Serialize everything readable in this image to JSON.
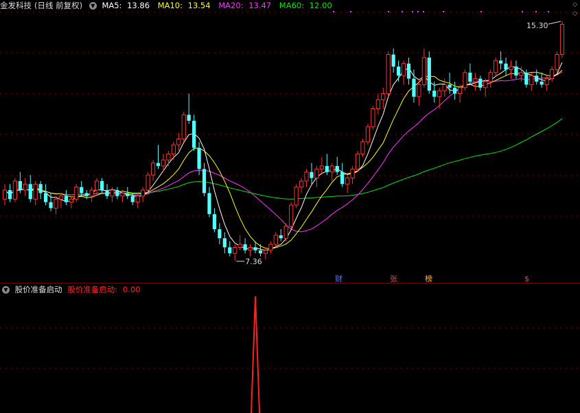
{
  "header": {
    "stock_name": "金发科技",
    "period": "(日线 前复权)",
    "ma5_label": "MA5:",
    "ma5_value": "13.86",
    "ma10_label": "MA10:",
    "ma10_value": "13.54",
    "ma20_label": "MA20:",
    "ma20_value": "13.47",
    "ma60_label": "MA60:",
    "ma60_value": "12.00",
    "icon": "chevron-down-icon"
  },
  "indicator": {
    "name": "股价准备启动",
    "series_label": "股价准备启动:",
    "value": "0.00",
    "icon": "chevron-down-icon"
  },
  "annotations": {
    "high_label": "15.30",
    "low_label": "7.36",
    "event_cai": "财",
    "event_zhang": "张",
    "event_bang": "榜",
    "event_dollar": "$"
  },
  "colors": {
    "up": "#ff3232",
    "down": "#54ffff",
    "ma5": "#ffffff",
    "ma10": "#ffff00",
    "ma20": "#ff33ff",
    "ma60": "#00e600",
    "grid": "#8b0000",
    "signal": "#ff2020"
  },
  "chart_data": [
    {
      "type": "candlestick",
      "title": "金发科技(日线 前复权)",
      "ylim": [
        6.9,
        15.6
      ],
      "annotations": [
        {
          "text": "15.30",
          "value": 15.3
        },
        {
          "text": "7.36",
          "value": 7.36
        }
      ],
      "candles": [
        [
          9.4,
          9.9,
          9.2,
          9.7
        ],
        [
          9.7,
          9.9,
          9.3,
          9.4
        ],
        [
          9.4,
          10.1,
          9.3,
          10.0
        ],
        [
          10.0,
          10.3,
          9.6,
          9.7
        ],
        [
          9.7,
          10.1,
          9.5,
          9.9
        ],
        [
          9.9,
          10.2,
          9.3,
          9.4
        ],
        [
          9.4,
          10.0,
          9.2,
          9.9
        ],
        [
          9.9,
          10.0,
          9.4,
          9.6
        ],
        [
          9.6,
          9.9,
          9.2,
          9.3
        ],
        [
          9.3,
          9.6,
          9.0,
          9.1
        ],
        [
          9.1,
          9.5,
          8.9,
          9.4
        ],
        [
          9.4,
          9.6,
          9.1,
          9.5
        ],
        [
          9.5,
          9.7,
          9.2,
          9.3
        ],
        [
          9.3,
          9.5,
          9.1,
          9.4
        ],
        [
          9.4,
          9.9,
          9.3,
          9.8
        ],
        [
          9.8,
          10.0,
          9.5,
          9.6
        ],
        [
          9.6,
          9.7,
          9.4,
          9.5
        ],
        [
          9.5,
          9.8,
          9.3,
          9.7
        ],
        [
          9.7,
          10.1,
          9.5,
          10.0
        ],
        [
          10.0,
          10.1,
          9.6,
          9.7
        ],
        [
          9.7,
          9.9,
          9.4,
          9.5
        ],
        [
          9.5,
          9.8,
          9.3,
          9.7
        ],
        [
          9.7,
          9.8,
          9.4,
          9.5
        ],
        [
          9.5,
          9.7,
          9.3,
          9.6
        ],
        [
          9.6,
          9.8,
          9.4,
          9.5
        ],
        [
          9.5,
          9.6,
          9.2,
          9.3
        ],
        [
          9.3,
          9.6,
          9.1,
          9.5
        ],
        [
          9.5,
          9.8,
          9.3,
          9.7
        ],
        [
          9.7,
          10.3,
          9.6,
          10.2
        ],
        [
          10.2,
          10.7,
          10.0,
          10.6
        ],
        [
          10.6,
          11.2,
          10.4,
          10.5
        ],
        [
          10.5,
          10.9,
          10.3,
          10.7
        ],
        [
          10.7,
          11.0,
          10.5,
          10.9
        ],
        [
          10.9,
          11.3,
          10.7,
          11.2
        ],
        [
          11.2,
          11.6,
          11.0,
          11.4
        ],
        [
          11.4,
          12.3,
          11.3,
          12.2
        ],
        [
          12.2,
          12.9,
          11.9,
          12.0
        ],
        [
          12.0,
          12.2,
          11.0,
          11.1
        ],
        [
          11.1,
          11.3,
          10.2,
          10.4
        ],
        [
          10.4,
          10.6,
          9.5,
          9.6
        ],
        [
          9.6,
          9.8,
          8.8,
          8.9
        ],
        [
          8.9,
          9.1,
          8.3,
          8.4
        ],
        [
          8.4,
          8.6,
          7.9,
          8.1
        ],
        [
          8.1,
          8.3,
          7.6,
          7.8
        ],
        [
          7.8,
          8.0,
          7.5,
          7.6
        ],
        [
          7.6,
          7.9,
          7.36,
          7.8
        ],
        [
          7.8,
          8.2,
          7.7,
          7.9
        ],
        [
          7.9,
          8.1,
          7.6,
          7.7
        ],
        [
          7.7,
          7.9,
          7.5,
          7.8
        ],
        [
          7.8,
          8.0,
          7.6,
          7.7
        ],
        [
          7.7,
          7.9,
          7.5,
          7.6
        ],
        [
          7.6,
          7.8,
          7.4,
          7.7
        ],
        [
          7.7,
          8.0,
          7.6,
          7.9
        ],
        [
          7.9,
          8.3,
          7.8,
          8.2
        ],
        [
          8.2,
          8.4,
          8.0,
          8.1
        ],
        [
          8.1,
          8.6,
          8.0,
          8.5
        ],
        [
          8.5,
          9.3,
          8.4,
          9.2
        ],
        [
          9.2,
          9.9,
          9.1,
          9.8
        ],
        [
          9.8,
          10.1,
          9.6,
          10.0
        ],
        [
          10.0,
          10.4,
          9.8,
          10.3
        ],
        [
          10.3,
          10.6,
          9.9,
          10.1
        ],
        [
          10.1,
          10.5,
          9.8,
          10.4
        ],
        [
          10.4,
          10.8,
          10.2,
          10.5
        ],
        [
          10.5,
          10.9,
          10.2,
          10.3
        ],
        [
          10.3,
          10.6,
          10.0,
          10.5
        ],
        [
          10.5,
          10.8,
          10.2,
          10.3
        ],
        [
          10.3,
          10.6,
          9.8,
          9.9
        ],
        [
          9.9,
          10.2,
          9.6,
          10.1
        ],
        [
          10.1,
          10.5,
          9.9,
          10.4
        ],
        [
          10.4,
          11.0,
          10.3,
          10.9
        ],
        [
          10.9,
          11.4,
          10.8,
          11.3
        ],
        [
          11.3,
          11.9,
          11.2,
          11.8
        ],
        [
          11.8,
          12.5,
          11.7,
          12.4
        ],
        [
          12.4,
          12.9,
          12.2,
          12.7
        ],
        [
          12.7,
          13.1,
          12.4,
          12.9
        ],
        [
          12.9,
          14.3,
          12.8,
          14.2
        ],
        [
          14.2,
          14.4,
          13.6,
          13.8
        ],
        [
          13.8,
          14.0,
          13.3,
          13.5
        ],
        [
          13.5,
          14.0,
          13.2,
          13.9
        ],
        [
          13.9,
          14.1,
          13.2,
          13.4
        ],
        [
          13.4,
          13.7,
          12.6,
          12.8
        ],
        [
          12.8,
          13.4,
          12.5,
          13.2
        ],
        [
          13.2,
          14.4,
          13.1,
          14.1
        ],
        [
          14.1,
          14.3,
          12.9,
          13.0
        ],
        [
          13.0,
          13.3,
          12.6,
          12.8
        ],
        [
          12.8,
          13.1,
          12.4,
          13.0
        ],
        [
          13.0,
          13.4,
          12.8,
          13.2
        ],
        [
          13.2,
          13.6,
          12.9,
          13.1
        ],
        [
          13.1,
          13.3,
          12.7,
          12.9
        ],
        [
          12.9,
          13.2,
          12.6,
          13.1
        ],
        [
          13.1,
          13.7,
          13.0,
          13.6
        ],
        [
          13.6,
          13.9,
          13.2,
          13.3
        ],
        [
          13.3,
          13.6,
          13.0,
          13.4
        ],
        [
          13.4,
          13.5,
          13.0,
          13.1
        ],
        [
          13.1,
          13.4,
          12.8,
          13.3
        ],
        [
          13.3,
          13.7,
          13.1,
          13.6
        ],
        [
          13.6,
          14.1,
          13.5,
          14.0
        ],
        [
          14.0,
          14.3,
          13.7,
          13.9
        ],
        [
          13.9,
          14.1,
          13.5,
          13.7
        ],
        [
          13.7,
          14.0,
          13.4,
          13.8
        ],
        [
          13.8,
          14.0,
          13.4,
          13.5
        ],
        [
          13.5,
          13.8,
          13.3,
          13.6
        ],
        [
          13.6,
          13.7,
          13.1,
          13.2
        ],
        [
          13.2,
          13.6,
          13.0,
          13.5
        ],
        [
          13.5,
          13.7,
          13.2,
          13.3
        ],
        [
          13.3,
          13.6,
          13.1,
          13.2
        ],
        [
          13.2,
          13.5,
          13.0,
          13.4
        ],
        [
          13.4,
          13.8,
          13.3,
          13.7
        ],
        [
          13.7,
          14.3,
          13.6,
          14.2
        ],
        [
          14.2,
          15.3,
          14.1,
          15.2
        ]
      ],
      "moving_averages": [
        {
          "name": "MA5",
          "value": 13.86
        },
        {
          "name": "MA10",
          "value": 13.54
        },
        {
          "name": "MA20",
          "value": 13.47
        },
        {
          "name": "MA60",
          "value": 12.0
        }
      ]
    },
    {
      "type": "line",
      "title": "股价准备启动",
      "series": [
        {
          "name": "股价准备启动",
          "signal_index": 49,
          "signal_value": 1,
          "last": 0.0
        }
      ]
    }
  ]
}
